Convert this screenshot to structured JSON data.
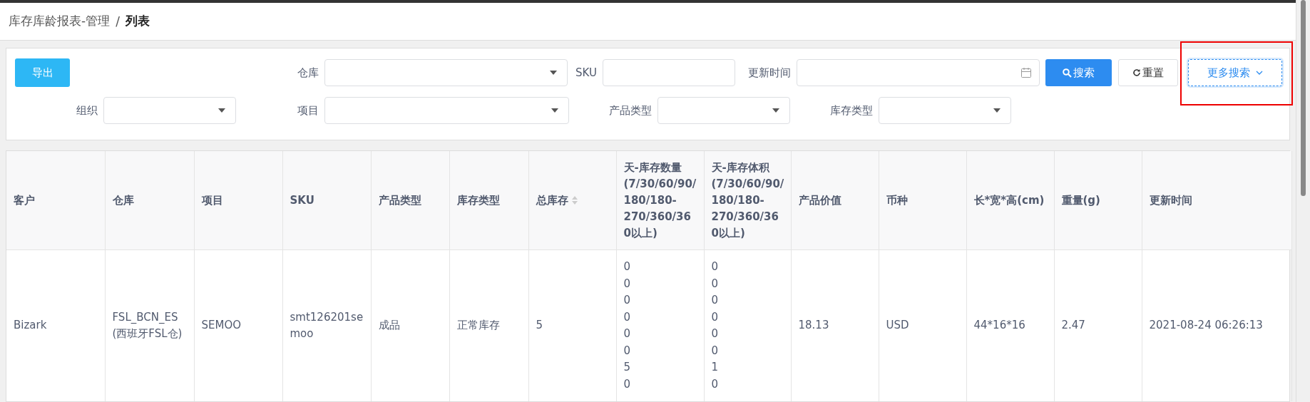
{
  "breadcrumb": {
    "parent": "库存库龄报表-管理",
    "separator": "/",
    "current": "列表"
  },
  "filters": {
    "export_button": "导出",
    "row1": [
      {
        "label": "仓库",
        "kind": "select"
      },
      {
        "label": "SKU",
        "kind": "text"
      },
      {
        "label": "更新时间",
        "kind": "date"
      }
    ],
    "search_button": "搜索",
    "reset_button": "重置",
    "more_button": {
      "label": "更多搜索",
      "highlighted": true
    },
    "row2": [
      {
        "label": "组织",
        "kind": "select"
      },
      {
        "label": "项目",
        "kind": "select"
      },
      {
        "label": "产品类型",
        "kind": "select"
      },
      {
        "label": "库存类型",
        "kind": "select"
      }
    ]
  },
  "table": {
    "columns": [
      {
        "label": "客户",
        "sortable": false
      },
      {
        "label": "仓库",
        "sortable": false
      },
      {
        "label": "项目",
        "sortable": false
      },
      {
        "label": "SKU",
        "sortable": false
      },
      {
        "label": "产品类型",
        "sortable": false
      },
      {
        "label": "库存类型",
        "sortable": false
      },
      {
        "label": "总库存",
        "sortable": true
      },
      {
        "label": "天-库存数量(7/30/60/90/180/180-270/360/360以上)",
        "sortable": false
      },
      {
        "label": "天-库存体积(7/30/60/90/180/180-270/360/360以上)",
        "sortable": false
      },
      {
        "label": "产品价值",
        "sortable": false
      },
      {
        "label": "币种",
        "sortable": false
      },
      {
        "label": "长*宽*高(cm)",
        "sortable": false
      },
      {
        "label": "重量(g)",
        "sortable": false
      },
      {
        "label": "更新时间",
        "sortable": false
      }
    ],
    "rows": [
      {
        "cells": [
          "Bizark",
          "FSL_BCN_ES(西班牙FSL仓)",
          "SEMOO",
          "smt126201semoo",
          "成品",
          "正常库存",
          "5",
          [
            "0",
            "0",
            "0",
            "0",
            "0",
            "0",
            "5",
            "0"
          ],
          [
            "0",
            "0",
            "0",
            "0",
            "0",
            "0",
            "1",
            "0"
          ],
          "18.13",
          "USD",
          "44*16*16",
          "2.47",
          "2021-08-24 06:26:13"
        ]
      }
    ]
  }
}
